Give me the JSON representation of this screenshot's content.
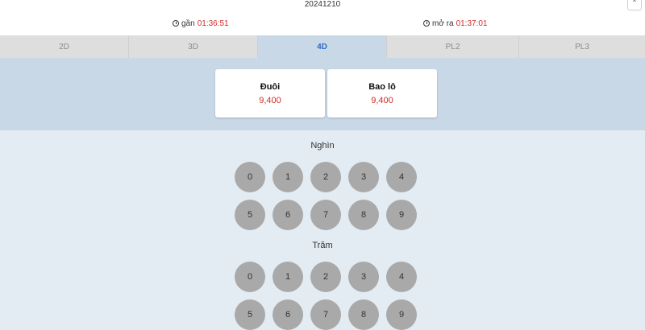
{
  "header": {
    "period": "20241210",
    "expand_icon": "expand-icon"
  },
  "timers": {
    "close_label": "gần",
    "close_time": "01:36:51",
    "open_label": "mở ra",
    "open_time": "01:37:01"
  },
  "tabs": [
    {
      "label": "2D",
      "active": false
    },
    {
      "label": "3D",
      "active": false
    },
    {
      "label": "4D",
      "active": true
    },
    {
      "label": "PL2",
      "active": false
    },
    {
      "label": "PL3",
      "active": false
    }
  ],
  "modes": [
    {
      "name": "Đuôi",
      "odds": "9,400"
    },
    {
      "name": "Bao lô",
      "odds": "9,400"
    }
  ],
  "sections": [
    {
      "title": "Nghìn",
      "numbers": [
        "0",
        "1",
        "2",
        "3",
        "4",
        "5",
        "6",
        "7",
        "8",
        "9"
      ]
    },
    {
      "title": "Trăm",
      "numbers": [
        "0",
        "1",
        "2",
        "3",
        "4",
        "5",
        "6",
        "7",
        "8",
        "9"
      ]
    }
  ],
  "colors": {
    "accent": "#d42a2a",
    "active_tab": "#2f6bc4",
    "panel": "#c8d8e6",
    "ball": "#a9a9a9"
  }
}
